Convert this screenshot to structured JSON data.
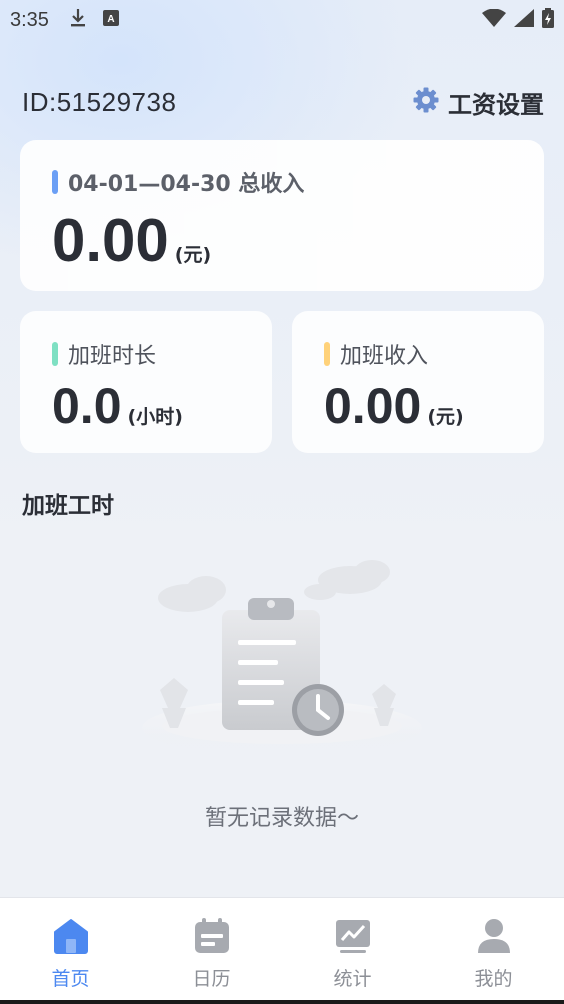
{
  "status_bar": {
    "time": "3:35",
    "icons": [
      "download-icon",
      "a-box-icon",
      "wifi-icon",
      "signal-icon",
      "battery-charging-icon"
    ]
  },
  "header": {
    "user_id": "ID:51529738",
    "settings_label": "工资设置",
    "settings_icon": "gear-icon"
  },
  "total_card": {
    "label": "04-01—04-30 总收入",
    "value": "0.00",
    "unit": "(元)",
    "accent": "#6b9ff5"
  },
  "ot_hours_card": {
    "label": "加班时长",
    "value": "0.0",
    "unit": "(小时)",
    "accent": "#7ee0c3"
  },
  "ot_income_card": {
    "label": "加班收入",
    "value": "0.00",
    "unit": "(元)",
    "accent": "#ffd27a"
  },
  "section": {
    "title": "加班工时",
    "empty_text": "暂无记录数据～"
  },
  "tabbar": {
    "active_color": "#4c88f0",
    "inactive_color": "#8c8f96",
    "tabs": [
      {
        "label": "首页",
        "icon": "home-icon",
        "active": true
      },
      {
        "label": "日历",
        "icon": "calendar-icon",
        "active": false
      },
      {
        "label": "统计",
        "icon": "chart-icon",
        "active": false
      },
      {
        "label": "我的",
        "icon": "user-icon",
        "active": false
      }
    ]
  }
}
